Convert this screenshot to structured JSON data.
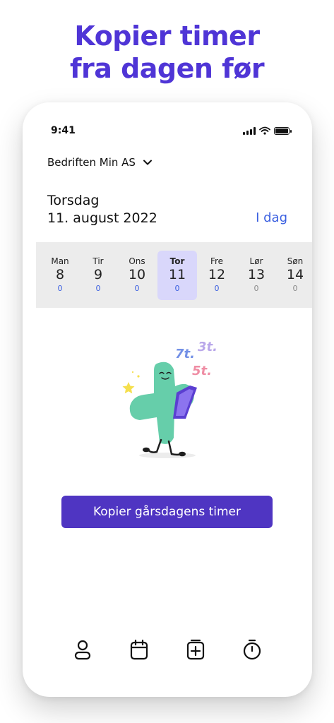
{
  "headline": {
    "line1": "Kopier timer",
    "line2": "fra dagen før"
  },
  "status_bar": {
    "time": "9:41"
  },
  "company": {
    "name": "Bedriften Min AS",
    "icon": "chevron-down-icon"
  },
  "date": {
    "weekday": "Torsdag",
    "full": "11. august 2022",
    "today_label": "I dag"
  },
  "week": [
    {
      "name": "Man",
      "num": "8",
      "hours": "0",
      "selected": false
    },
    {
      "name": "Tir",
      "num": "9",
      "hours": "0",
      "selected": false
    },
    {
      "name": "Ons",
      "num": "10",
      "hours": "0",
      "selected": false
    },
    {
      "name": "Tor",
      "num": "11",
      "hours": "0",
      "selected": true
    },
    {
      "name": "Fre",
      "num": "12",
      "hours": "0",
      "selected": false
    },
    {
      "name": "Lør",
      "num": "13",
      "hours": "0",
      "selected": false
    },
    {
      "name": "Søn",
      "num": "14",
      "hours": "0",
      "selected": false
    }
  ],
  "illustration": {
    "labels": [
      "7t.",
      "3t.",
      "5t."
    ]
  },
  "copy_button": {
    "label": "Kopier gårsdagens timer"
  },
  "tabs": [
    {
      "icon": "profile-icon"
    },
    {
      "icon": "calendar-icon"
    },
    {
      "icon": "add-hours-icon"
    },
    {
      "icon": "stopwatch-icon"
    }
  ],
  "colors": {
    "brand": "#4f35d6",
    "button": "#4f35c2",
    "selected_day": "#d9d7fb",
    "hours_blue": "#3a5fe0",
    "hours_grey": "#8a8a8a"
  }
}
